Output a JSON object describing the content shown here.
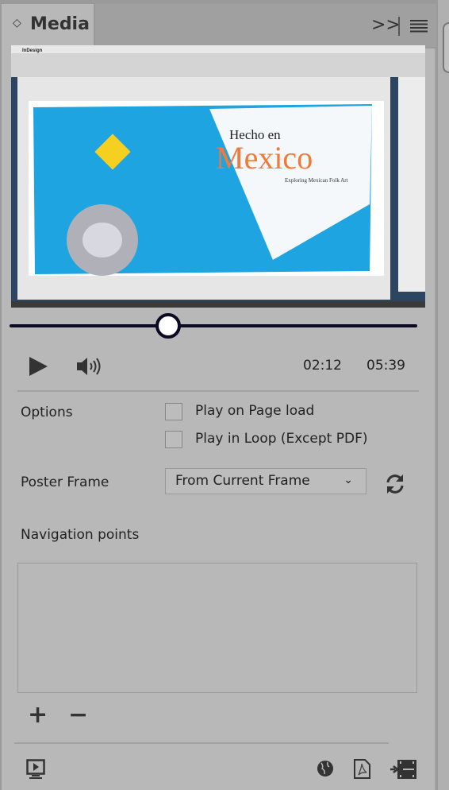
{
  "panel": {
    "title": "Media",
    "collapse_icon": "chevron-updown-icon",
    "overflow_icon": "double-chevron-right-icon",
    "menu_icon": "hamburger-menu-icon"
  },
  "preview": {
    "headline_small": "Hecho en",
    "headline_large": "Mexico",
    "subtitle": "Exploring Mexican Folk Art",
    "app": "InDesign",
    "colors": {
      "spread": "#1ea4e0",
      "accent": "#f07a3a"
    }
  },
  "player": {
    "progress": 0.39,
    "current_time": "02:12",
    "duration": "05:39",
    "play_icon": "play-icon",
    "volume_icon": "speaker-icon"
  },
  "options": {
    "label": "Options",
    "play_on_load": {
      "label": "Play on Page load",
      "checked": false
    },
    "play_in_loop": {
      "label": "Play in Loop (Except PDF)",
      "checked": false
    }
  },
  "poster": {
    "label": "Poster Frame",
    "value": "From Current Frame",
    "refresh_icon": "refresh-icon"
  },
  "navigation": {
    "label": "Navigation points",
    "add": "+",
    "remove": "−"
  },
  "footer": {
    "icons": [
      "preview-monitor-icon",
      "globe-icon",
      "pdf-icon",
      "place-video-icon"
    ]
  }
}
